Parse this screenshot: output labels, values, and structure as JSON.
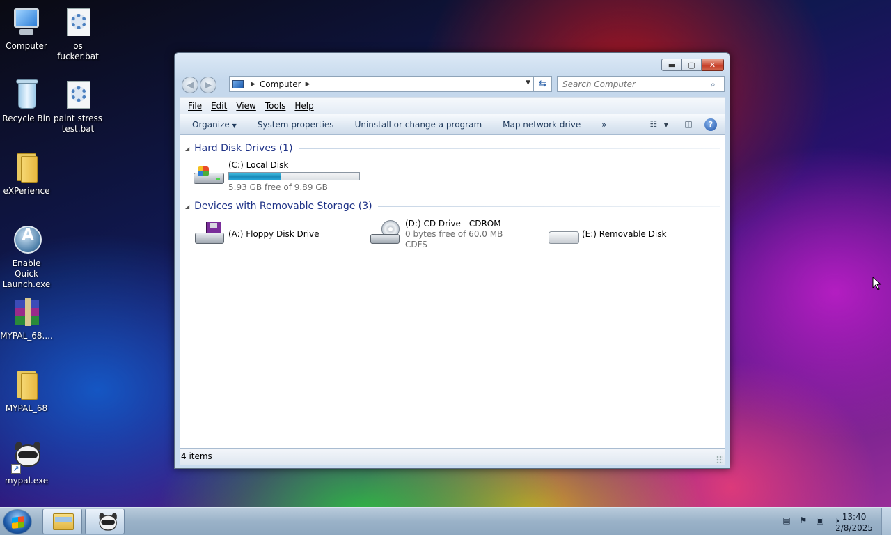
{
  "desktop": {
    "icons": [
      {
        "label": "Computer"
      },
      {
        "label": "os fucker.bat"
      },
      {
        "label": "Recycle Bin"
      },
      {
        "label": "paint stress test.bat"
      },
      {
        "label": "eXPerience"
      },
      {
        "label": "Enable Quick Launch.exe"
      },
      {
        "label": "MYPAL_68...."
      },
      {
        "label": "MYPAL_68"
      },
      {
        "label": "mypal.exe"
      }
    ]
  },
  "window": {
    "controls": {
      "minimize": "▬",
      "maximize": "▢",
      "close": "✕"
    },
    "address": {
      "location": "Computer"
    },
    "search": {
      "placeholder": "Search Computer"
    },
    "menu": [
      "File",
      "Edit",
      "View",
      "Tools",
      "Help"
    ],
    "toolbar": {
      "organize": "Organize",
      "system_properties": "System properties",
      "uninstall": "Uninstall or change a program",
      "map_network": "Map network drive",
      "more": "»"
    },
    "groups": [
      {
        "title": "Hard Disk Drives (1)",
        "items": [
          {
            "name": "(C:) Local Disk",
            "free_text": "5.93 GB free of 9.89 GB",
            "used_fraction": 0.4
          }
        ]
      },
      {
        "title": "Devices with Removable Storage (3)",
        "items": [
          {
            "name": "(A:) Floppy Disk Drive"
          },
          {
            "name": "(D:) CD Drive - CDROM",
            "free_text": "0 bytes free of 60.0 MB",
            "fs": "CDFS"
          },
          {
            "name": "(E:) Removable Disk"
          }
        ]
      }
    ],
    "status": "4 items"
  },
  "taskbar": {
    "time": "13:40",
    "date": "2/8/2025"
  },
  "colors": {
    "group_title": "#1e3287",
    "progress_fill": "#1a8ab8",
    "close_button": "#c7402a"
  }
}
